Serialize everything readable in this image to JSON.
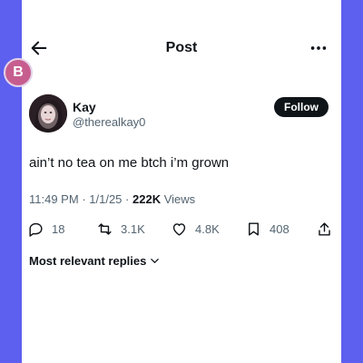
{
  "header": {
    "title": "Post",
    "back_icon": "arrow-left-icon",
    "more_icon": "more-horizontal-icon"
  },
  "overlay_badge": {
    "letter": "B",
    "color": "#c75d8f"
  },
  "tweet": {
    "author_name": "Kay",
    "author_handle": "@therealkay0",
    "follow_label": "Follow",
    "text": "ain’t no tea on me btch i’m grown",
    "time": "11:49 PM",
    "date": "1/1/25",
    "views_count": "222K",
    "views_label": "Views"
  },
  "actions": {
    "replies": "18",
    "reposts": "3.1K",
    "likes": "4.8K",
    "bookmarks": "408"
  },
  "replies_sort": {
    "label": "Most relevant replies"
  },
  "colors": {
    "accent_frame": "#5d5fef",
    "text": "#0f1419",
    "muted": "#536471"
  }
}
